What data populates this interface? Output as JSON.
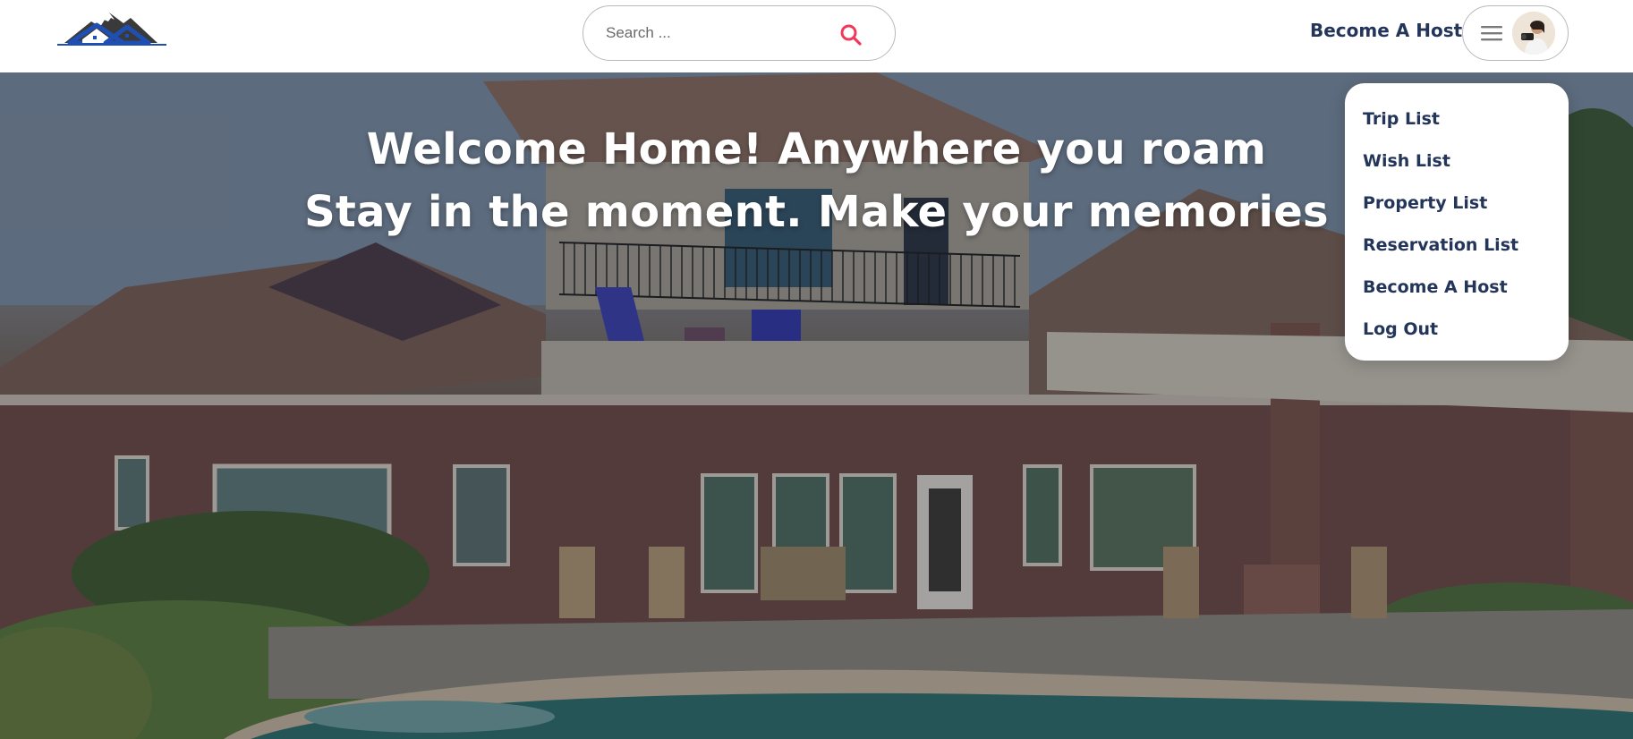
{
  "navbar": {
    "logo_icon": "house-mountain-logo",
    "search": {
      "placeholder": "Search ...",
      "icon": "search-icon"
    },
    "become_host_label": "Become A Host",
    "menu_icon": "hamburger-icon",
    "avatar_icon": "user-avatar"
  },
  "hero": {
    "line1": "Welcome Home! Anywhere you roam",
    "line2": "Stay in the moment. Make your memories"
  },
  "dropdown": {
    "items": [
      {
        "label": "Trip List"
      },
      {
        "label": "Wish List"
      },
      {
        "label": "Property List"
      },
      {
        "label": "Reservation List"
      },
      {
        "label": "Become A Host"
      },
      {
        "label": "Log Out"
      }
    ]
  },
  "colors": {
    "text_navy": "#24355a",
    "accent_red": "#f2385a",
    "logo_blue": "#1f4fb3",
    "border_gray": "#b9b9b9"
  }
}
